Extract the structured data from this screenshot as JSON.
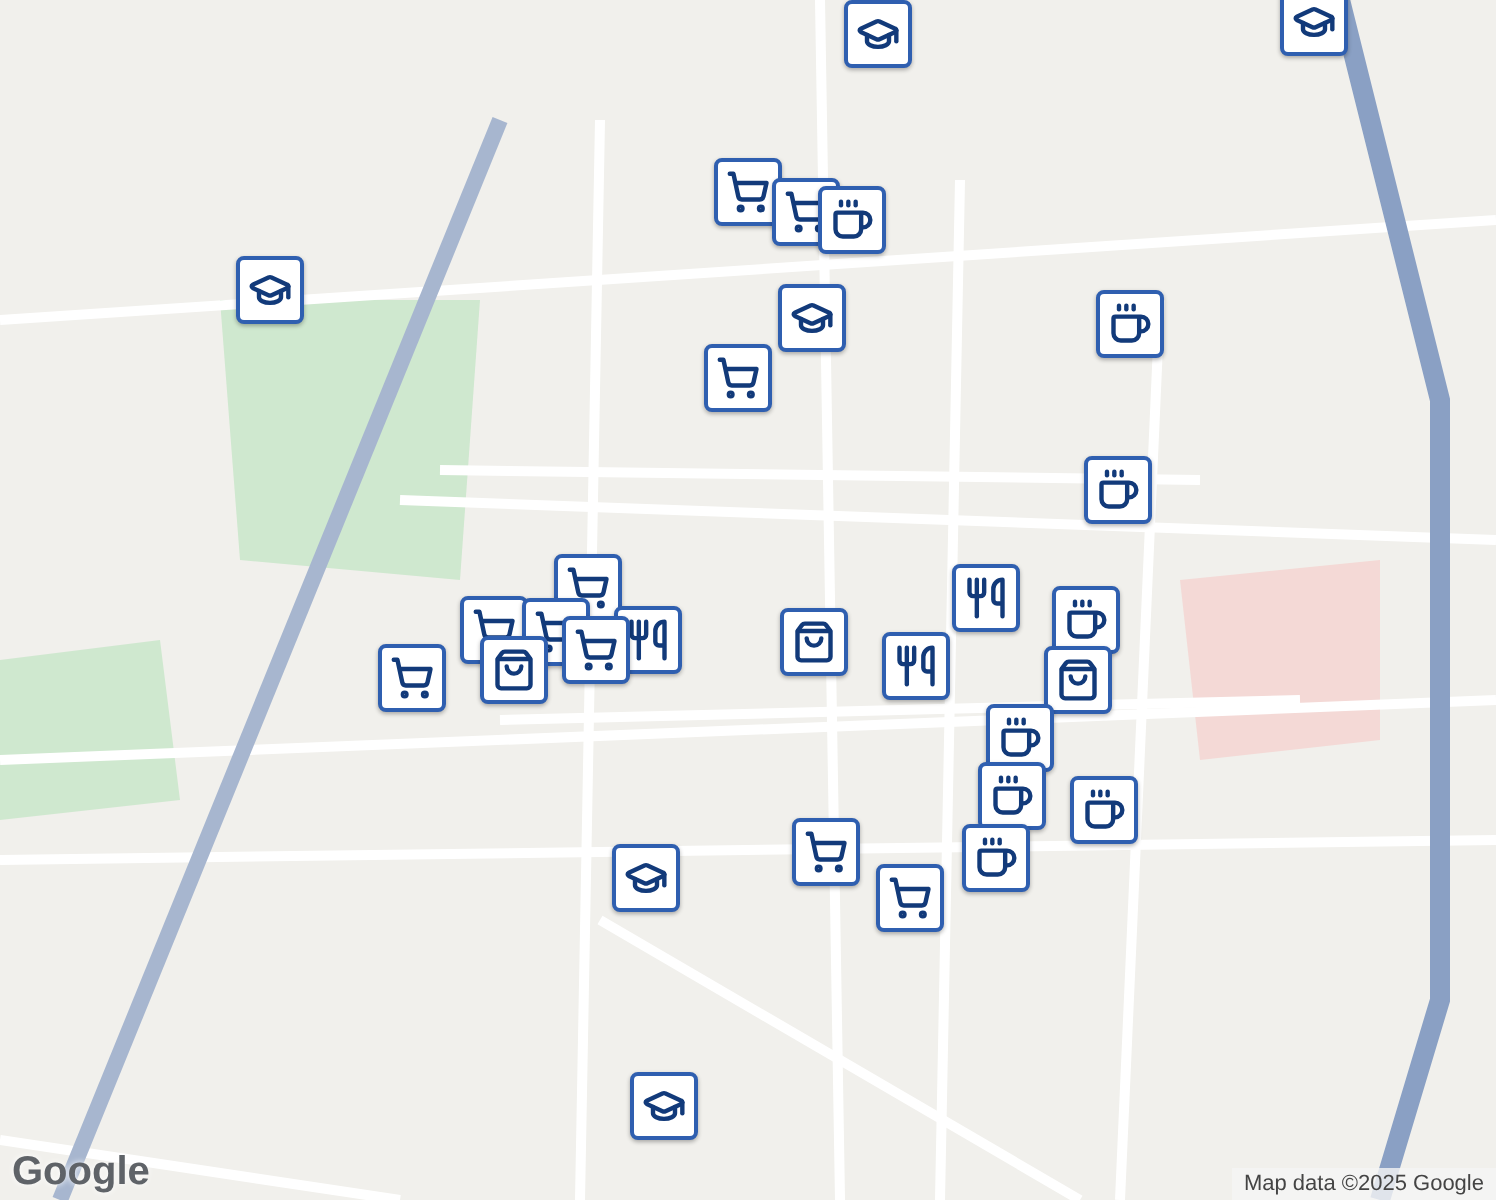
{
  "markers": [
    {
      "kind": "school"
    },
    {
      "kind": "school"
    },
    {
      "kind": "school"
    },
    {
      "kind": "school"
    },
    {
      "kind": "school"
    },
    {
      "kind": "school"
    },
    {
      "kind": "cart"
    },
    {
      "kind": "cart"
    },
    {
      "kind": "coffee"
    },
    {
      "kind": "coffee"
    },
    {
      "kind": "cart"
    },
    {
      "kind": "coffee"
    },
    {
      "kind": "cart"
    },
    {
      "kind": "cart"
    },
    {
      "kind": "cart"
    },
    {
      "kind": "dining"
    },
    {
      "kind": "bag"
    },
    {
      "kind": "cart"
    },
    {
      "kind": "bag"
    },
    {
      "kind": "dining"
    },
    {
      "kind": "dining"
    },
    {
      "kind": "coffee"
    },
    {
      "kind": "bag"
    },
    {
      "kind": "coffee"
    },
    {
      "kind": "coffee"
    },
    {
      "kind": "coffee"
    },
    {
      "kind": "coffee"
    },
    {
      "kind": "cart"
    },
    {
      "kind": "cart"
    },
    {
      "kind": "cart"
    }
  ],
  "logo": "Google",
  "attribution": "Map data ©2025 Google"
}
